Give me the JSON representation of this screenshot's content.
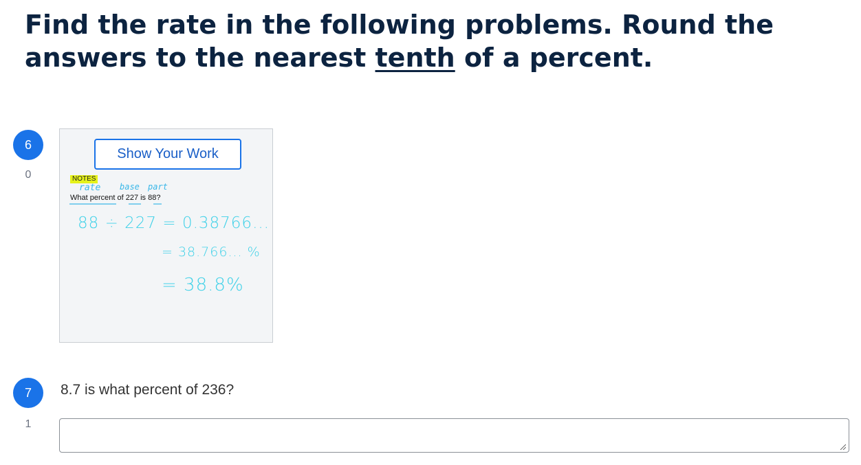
{
  "instructions": {
    "part1": "Find the rate in the following problems. Round the answers to the nearest ",
    "underlined": "tenth",
    "part2": " of a percent."
  },
  "questions": [
    {
      "number": "6",
      "count": "0",
      "show_work_label": "Show Your Work",
      "notes_tag": "NOTES",
      "labels": {
        "rate": "rate",
        "base": "base",
        "part": "part"
      },
      "question_text": "What percent of 227 is 88?",
      "work_lines": [
        "88 ÷ 227 = 0.38766...",
        "= 38.766... %",
        "= 38.8%"
      ]
    },
    {
      "number": "7",
      "count": "1",
      "question_text": "8.7 is what percent of 236?",
      "answer_value": "",
      "answer_placeholder": ""
    }
  ],
  "colors": {
    "accent": "#1a73e8",
    "heading": "#0c2340",
    "handwriting": "#3fd1e8",
    "highlight": "#e6f21a"
  }
}
